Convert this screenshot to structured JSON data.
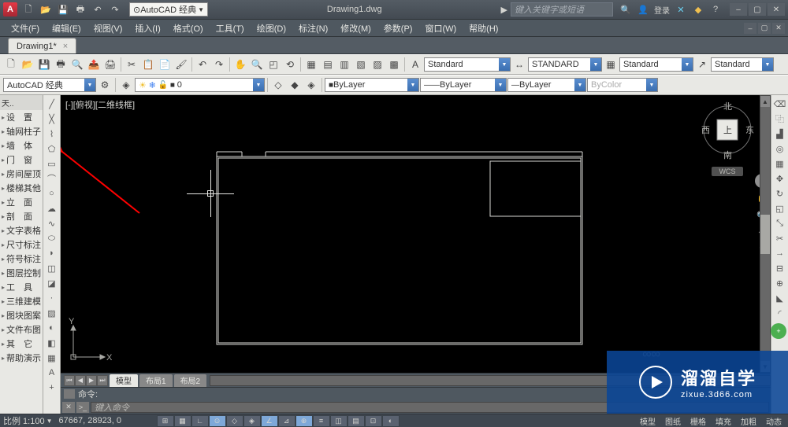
{
  "title": "Drawing1.dwg",
  "workspace_selector": "⊙AutoCAD 经典",
  "search_placeholder": "键入关键字或短语",
  "login_label": "登录",
  "menus": [
    "文件(F)",
    "编辑(E)",
    "视图(V)",
    "插入(I)",
    "格式(O)",
    "工具(T)",
    "绘图(D)",
    "标注(N)",
    "修改(M)",
    "参数(P)",
    "窗口(W)",
    "帮助(H)"
  ],
  "doc_tab": "Drawing1*",
  "props_row": {
    "workspace": "AutoCAD 经典",
    "layer_combo": "0",
    "linetype1": "ByLayer",
    "linetype2": "ByLayer",
    "linetype3": "ByLayer",
    "color": "ByColor",
    "style1": "Standard",
    "style2": "STANDARD",
    "style3": "Standard",
    "style4": "Standard"
  },
  "tree": {
    "title": "天..",
    "items": [
      "设　置",
      "轴网柱子",
      "墙　体",
      "门　窗",
      "房间屋顶",
      "楼梯其他",
      "立　面",
      "剖　面",
      "文字表格",
      "尺寸标注",
      "符号标注",
      "图层控制",
      "工　具",
      "三维建模",
      "图块图案",
      "文件布图",
      "其　它",
      "帮助演示"
    ]
  },
  "viewport_label": "[-][俯视][二维线框]",
  "viewcube": {
    "n": "北",
    "s": "南",
    "e": "东",
    "w": "西",
    "top": "上",
    "wcs": "WCS"
  },
  "ucs": {
    "x": "X",
    "y": "Y"
  },
  "layout_tabs": [
    "模型",
    "布局1",
    "布局2"
  ],
  "cmd_hist": "命令:",
  "cmd_placeholder": "键入命令",
  "status": {
    "scale": "比例 1:100",
    "coords": "67667, 28923, 0",
    "right_items": [
      "模型",
      "图纸",
      "栅格",
      "填充",
      "加粗",
      "动态"
    ]
  },
  "watermark": {
    "brand": "溜溜自学",
    "url": "zixue.3d66.com"
  }
}
